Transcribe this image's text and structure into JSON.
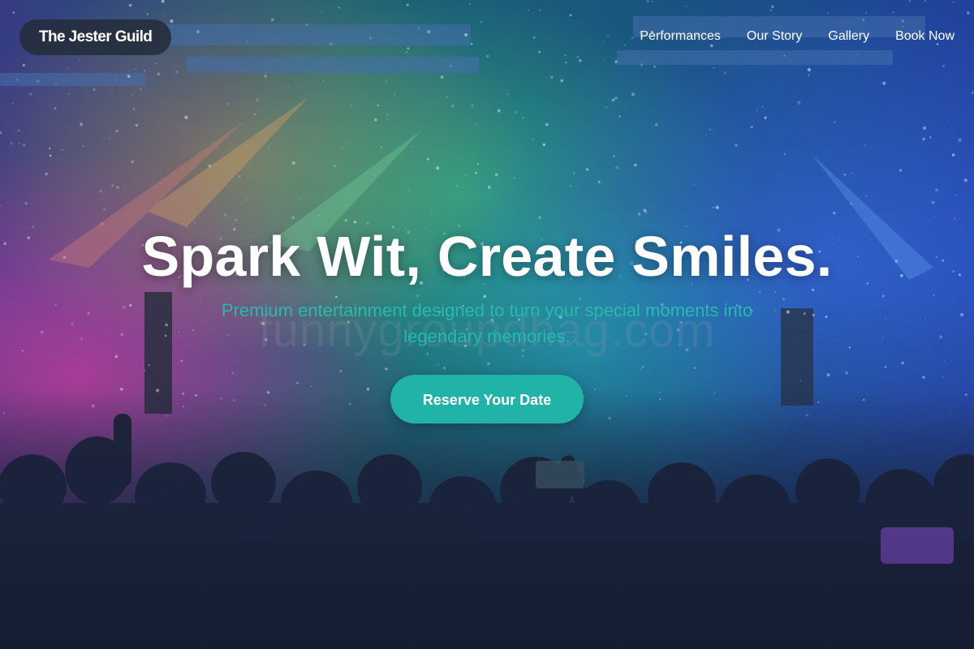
{
  "header": {
    "brand": "The Jester Guild",
    "nav": [
      {
        "label": "Performances"
      },
      {
        "label": "Our Story"
      },
      {
        "label": "Gallery"
      },
      {
        "label": "Book Now"
      }
    ]
  },
  "hero": {
    "headline": "Spark Wit, Create Smiles.",
    "subheadline": "Premium entertainment designed to turn your special moments into legendary memories.",
    "cta_label": "Reserve Your Date",
    "watermark": "funnygroupdhag.com",
    "background_description_icon": "concert-crowd-image"
  },
  "colors": {
    "accent": "#21b3a7",
    "subheadline": "#2ab8ad",
    "brand_pill": "#242c3a",
    "text": "#ffffff"
  }
}
